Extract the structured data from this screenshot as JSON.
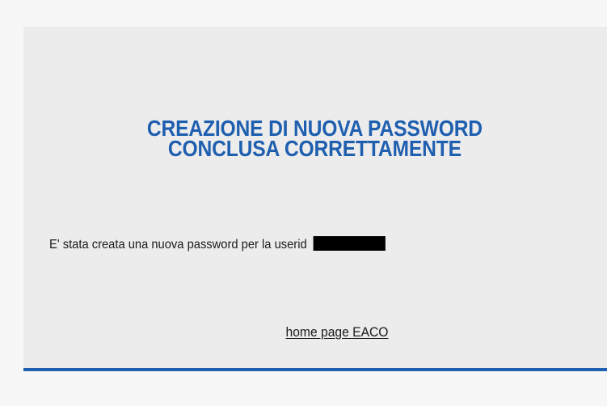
{
  "confirmation": {
    "title_line1": "CREAZIONE DI NUOVA PASSWORD",
    "title_line2": "CONCLUSA CORRETTAMENTE",
    "message": "E' stata creata una nuova password per la userid",
    "userid_redacted": true,
    "home_link_label": "home page EACO"
  },
  "colors": {
    "accent": "#1f5fb0",
    "panel_background": "#ececec",
    "page_background": "#f7f7f7",
    "text": "#1a1a1a",
    "redaction": "#000000"
  }
}
